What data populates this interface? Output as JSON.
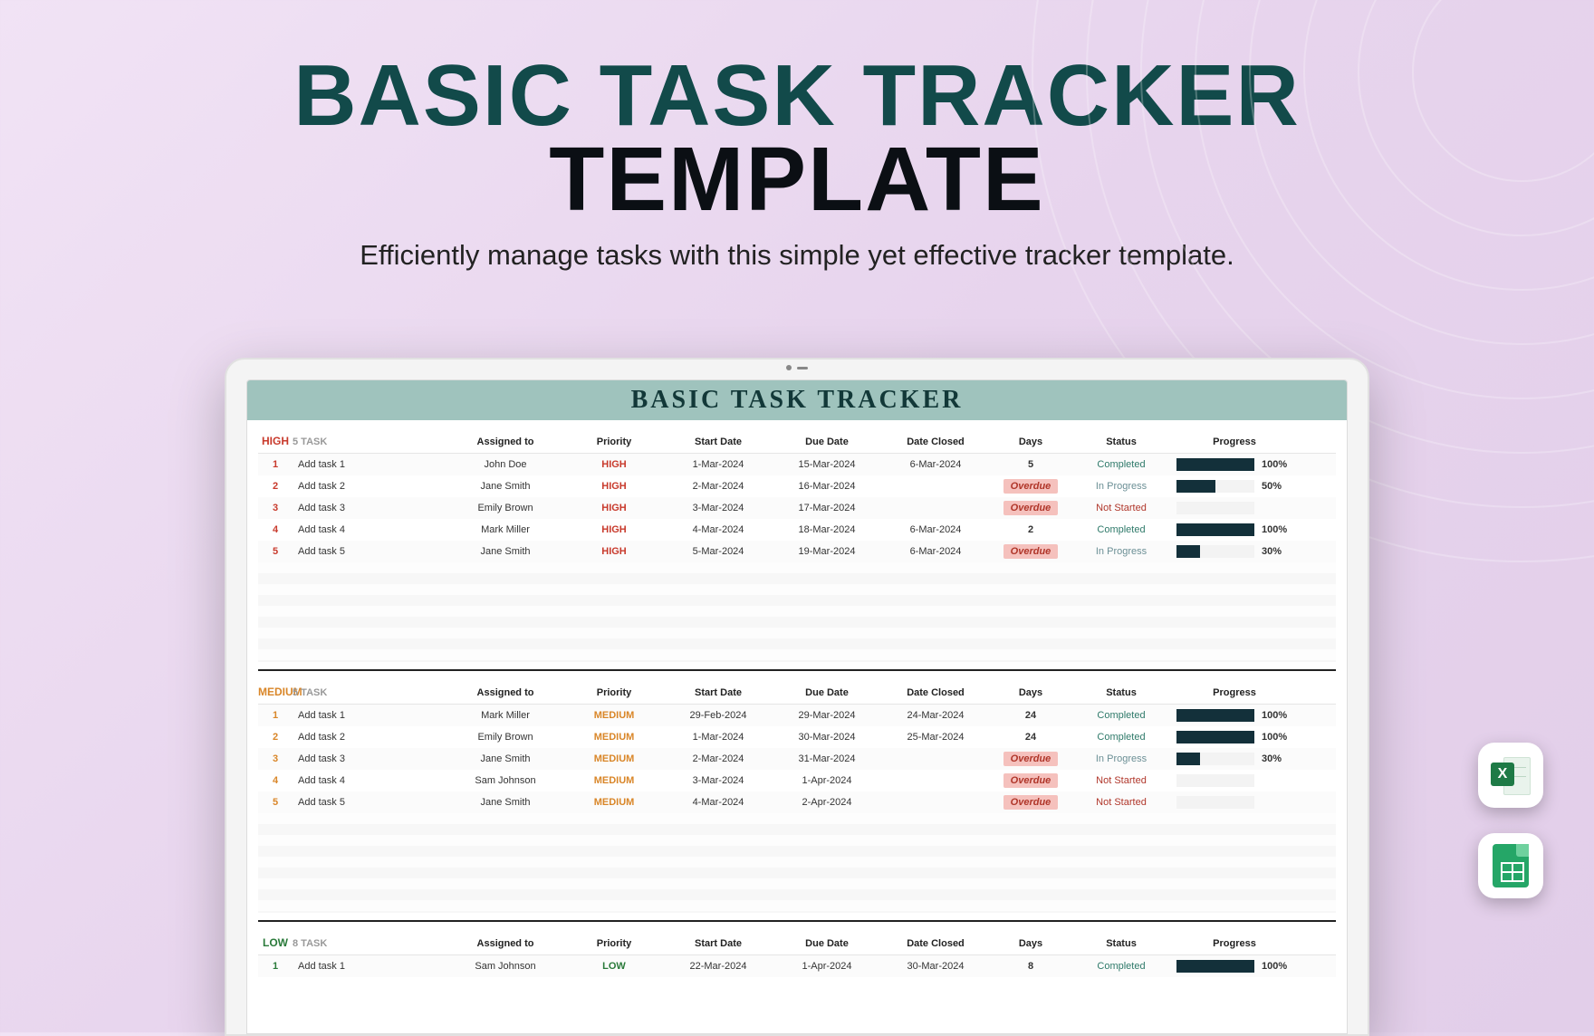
{
  "hero": {
    "title_line1": "BASIC TASK TRACKER",
    "title_line2": "TEMPLATE",
    "subtitle": "Efficiently manage tasks with this simple yet effective tracker template."
  },
  "sheet": {
    "header": "BASIC TASK TRACKER",
    "columns": {
      "assigned": "Assigned to",
      "priority": "Priority",
      "start": "Start Date",
      "due": "Due Date",
      "closed": "Date Closed",
      "days": "Days",
      "status": "Status",
      "progress": "Progress"
    },
    "groups": [
      {
        "name": "HIGH",
        "count_label": "5 TASK",
        "color_class": "priority-high",
        "rows": [
          {
            "n": "1",
            "task": "Add task 1",
            "assigned": "John Doe",
            "priority": "HIGH",
            "start": "1-Mar-2024",
            "due": "15-Mar-2024",
            "closed": "6-Mar-2024",
            "days": "5",
            "overdue": false,
            "status": "Completed",
            "status_class": "status-completed",
            "progress": 100
          },
          {
            "n": "2",
            "task": "Add task 2",
            "assigned": "Jane Smith",
            "priority": "HIGH",
            "start": "2-Mar-2024",
            "due": "16-Mar-2024",
            "closed": "",
            "days": "",
            "overdue": true,
            "status": "In Progress",
            "status_class": "status-inprogress",
            "progress": 50
          },
          {
            "n": "3",
            "task": "Add task 3",
            "assigned": "Emily Brown",
            "priority": "HIGH",
            "start": "3-Mar-2024",
            "due": "17-Mar-2024",
            "closed": "",
            "days": "",
            "overdue": true,
            "status": "Not Started",
            "status_class": "status-notstarted",
            "progress": 0
          },
          {
            "n": "4",
            "task": "Add task 4",
            "assigned": "Mark Miller",
            "priority": "HIGH",
            "start": "4-Mar-2024",
            "due": "18-Mar-2024",
            "closed": "6-Mar-2024",
            "days": "2",
            "overdue": false,
            "status": "Completed",
            "status_class": "status-completed",
            "progress": 100
          },
          {
            "n": "5",
            "task": "Add task 5",
            "assigned": "Jane Smith",
            "priority": "HIGH",
            "start": "5-Mar-2024",
            "due": "19-Mar-2024",
            "closed": "6-Mar-2024",
            "days": "",
            "overdue": true,
            "status": "In Progress",
            "status_class": "status-inprogress",
            "progress": 30
          }
        ]
      },
      {
        "name": "MEDIUM",
        "count_label": "5 TASK",
        "color_class": "priority-medium",
        "rows": [
          {
            "n": "1",
            "task": "Add task 1",
            "assigned": "Mark Miller",
            "priority": "MEDIUM",
            "start": "29-Feb-2024",
            "due": "29-Mar-2024",
            "closed": "24-Mar-2024",
            "days": "24",
            "overdue": false,
            "status": "Completed",
            "status_class": "status-completed",
            "progress": 100
          },
          {
            "n": "2",
            "task": "Add task 2",
            "assigned": "Emily Brown",
            "priority": "MEDIUM",
            "start": "1-Mar-2024",
            "due": "30-Mar-2024",
            "closed": "25-Mar-2024",
            "days": "24",
            "overdue": false,
            "status": "Completed",
            "status_class": "status-completed",
            "progress": 100
          },
          {
            "n": "3",
            "task": "Add task 3",
            "assigned": "Jane Smith",
            "priority": "MEDIUM",
            "start": "2-Mar-2024",
            "due": "31-Mar-2024",
            "closed": "",
            "days": "",
            "overdue": true,
            "status": "In Progress",
            "status_class": "status-inprogress",
            "progress": 30
          },
          {
            "n": "4",
            "task": "Add task 4",
            "assigned": "Sam Johnson",
            "priority": "MEDIUM",
            "start": "3-Mar-2024",
            "due": "1-Apr-2024",
            "closed": "",
            "days": "",
            "overdue": true,
            "status": "Not Started",
            "status_class": "status-notstarted",
            "progress": 0
          },
          {
            "n": "5",
            "task": "Add task 5",
            "assigned": "Jane Smith",
            "priority": "MEDIUM",
            "start": "4-Mar-2024",
            "due": "2-Apr-2024",
            "closed": "",
            "days": "",
            "overdue": true,
            "status": "Not Started",
            "status_class": "status-notstarted",
            "progress": 0
          }
        ]
      },
      {
        "name": "LOW",
        "count_label": "8 TASK",
        "color_class": "priority-low",
        "rows": [
          {
            "n": "1",
            "task": "Add task 1",
            "assigned": "Sam Johnson",
            "priority": "LOW",
            "start": "22-Mar-2024",
            "due": "1-Apr-2024",
            "closed": "30-Mar-2024",
            "days": "8",
            "overdue": false,
            "status": "Completed",
            "status_class": "status-completed",
            "progress": 100
          }
        ]
      }
    ],
    "overdue_label": "Overdue"
  },
  "badges": {
    "excel_letter": "X"
  }
}
